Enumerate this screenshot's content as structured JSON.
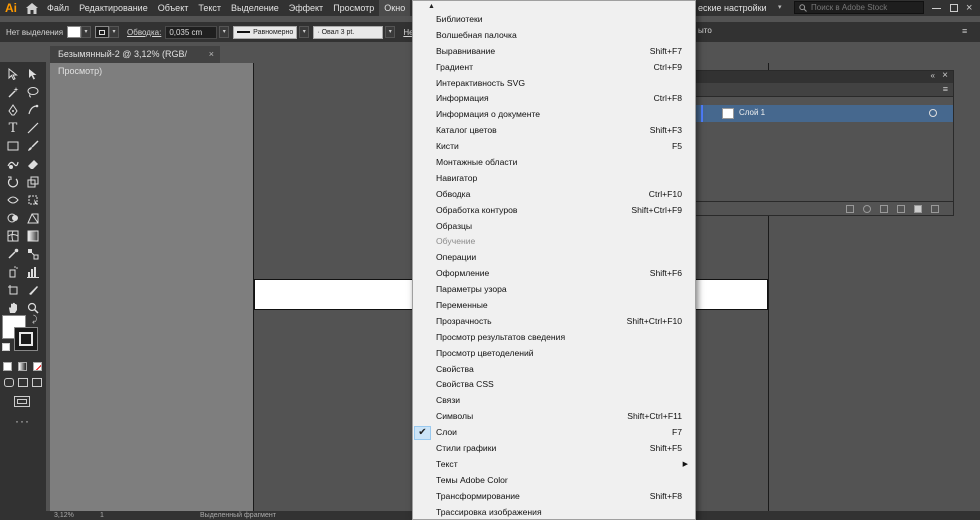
{
  "app": {
    "logo": "Ai"
  },
  "menubar": {
    "items": [
      "Файл",
      "Редактирование",
      "Объект",
      "Текст",
      "Выделение",
      "Эффект",
      "Просмотр",
      "Окно"
    ],
    "workspace_label": "еские настройки",
    "search_placeholder": "Поиск в Adobe Stock"
  },
  "controlbar": {
    "selection_label": "Нет выделения",
    "stroke_label": "Обводка:",
    "stroke_value": "0,035 cm",
    "stroke_profile": "Равномерно",
    "brush_value": "Овал 3 pt.",
    "opacity_label": "Непр",
    "trailing_label": "ыто"
  },
  "document": {
    "tab_title": "Безымянный-2 @ 3,12% (RGB/Просмотр)",
    "close": "×"
  },
  "statusbar": {
    "zoom": "3,12%",
    "artboard_number": "1",
    "tool_name": "Выделенный фрагмент"
  },
  "layers_panel": {
    "layer_name": "Слой 1"
  },
  "window_menu": {
    "items": [
      {
        "label": "Библиотеки",
        "shortcut": ""
      },
      {
        "label": "Волшебная палочка",
        "shortcut": ""
      },
      {
        "label": "Выравнивание",
        "shortcut": "Shift+F7"
      },
      {
        "label": "Градиент",
        "shortcut": "Ctrl+F9"
      },
      {
        "label": "Интерактивность SVG",
        "shortcut": ""
      },
      {
        "label": "Информация",
        "shortcut": "Ctrl+F8"
      },
      {
        "label": "Информация о документе",
        "shortcut": ""
      },
      {
        "label": "Каталог цветов",
        "shortcut": "Shift+F3"
      },
      {
        "label": "Кисти",
        "shortcut": "F5"
      },
      {
        "label": "Монтажные области",
        "shortcut": ""
      },
      {
        "label": "Навигатор",
        "shortcut": ""
      },
      {
        "label": "Обводка",
        "shortcut": "Ctrl+F10"
      },
      {
        "label": "Обработка контуров",
        "shortcut": "Shift+Ctrl+F9"
      },
      {
        "label": "Образцы",
        "shortcut": ""
      },
      {
        "label": "Обучение",
        "shortcut": "",
        "disabled": true
      },
      {
        "label": "Операции",
        "shortcut": ""
      },
      {
        "label": "Оформление",
        "shortcut": "Shift+F6"
      },
      {
        "label": "Параметры узора",
        "shortcut": ""
      },
      {
        "label": "Переменные",
        "shortcut": ""
      },
      {
        "label": "Прозрачность",
        "shortcut": "Shift+Ctrl+F10"
      },
      {
        "label": "Просмотр результатов сведения",
        "shortcut": ""
      },
      {
        "label": "Просмотр цветоделений",
        "shortcut": ""
      },
      {
        "label": "Свойства",
        "shortcut": ""
      },
      {
        "label": "Свойства CSS",
        "shortcut": ""
      },
      {
        "label": "Связи",
        "shortcut": ""
      },
      {
        "label": "Символы",
        "shortcut": "Shift+Ctrl+F11"
      },
      {
        "label": "Слои",
        "shortcut": "F7",
        "checked": true
      },
      {
        "label": "Стили графики",
        "shortcut": "Shift+F5"
      },
      {
        "label": "Текст",
        "shortcut": "",
        "submenu": true
      },
      {
        "label": "Темы Adobe Color",
        "shortcut": ""
      },
      {
        "label": "Трансформирование",
        "shortcut": "Shift+F8"
      },
      {
        "label": "Трассировка изображения",
        "shortcut": ""
      }
    ]
  },
  "colors": {
    "accent": "#ff9a00",
    "selected_layer": "#46688e",
    "menu_bg": "#f0f0f0"
  }
}
